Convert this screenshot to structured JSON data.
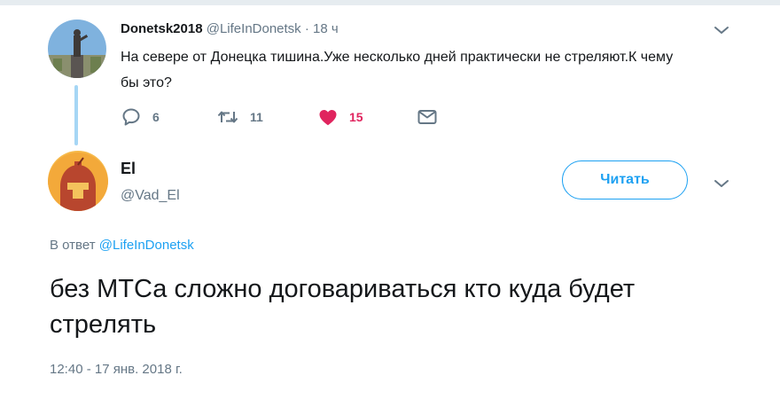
{
  "parent_tweet": {
    "display_name": "Donetsk2018",
    "handle": "@LifeInDonetsk",
    "separator": "·",
    "time": "18 ч",
    "text": "На севере от Донецка тишина.Уже несколько дней практически не стреляют.К чему бы это?",
    "actions": {
      "replies": "6",
      "retweets": "11",
      "likes": "15"
    }
  },
  "main_tweet": {
    "display_name": "El",
    "handle": "@Vad_El",
    "follow_label": "Читать",
    "reply_prefix": "В ответ",
    "reply_to": "@LifeInDonetsk",
    "text": "без МТСа сложно договариваться кто куда будет стрелять",
    "timestamp": "12:40 - 17 янв. 2018 г."
  },
  "icons": {
    "reply": "reply-icon",
    "retweet": "retweet-icon",
    "like": "heart-icon",
    "dm": "envelope-icon",
    "menu": "chevron-down-icon"
  },
  "colors": {
    "accent": "#1da1f2",
    "like": "#e0245e",
    "secondary_text": "#657786",
    "thread_line": "#a6d6f5"
  }
}
